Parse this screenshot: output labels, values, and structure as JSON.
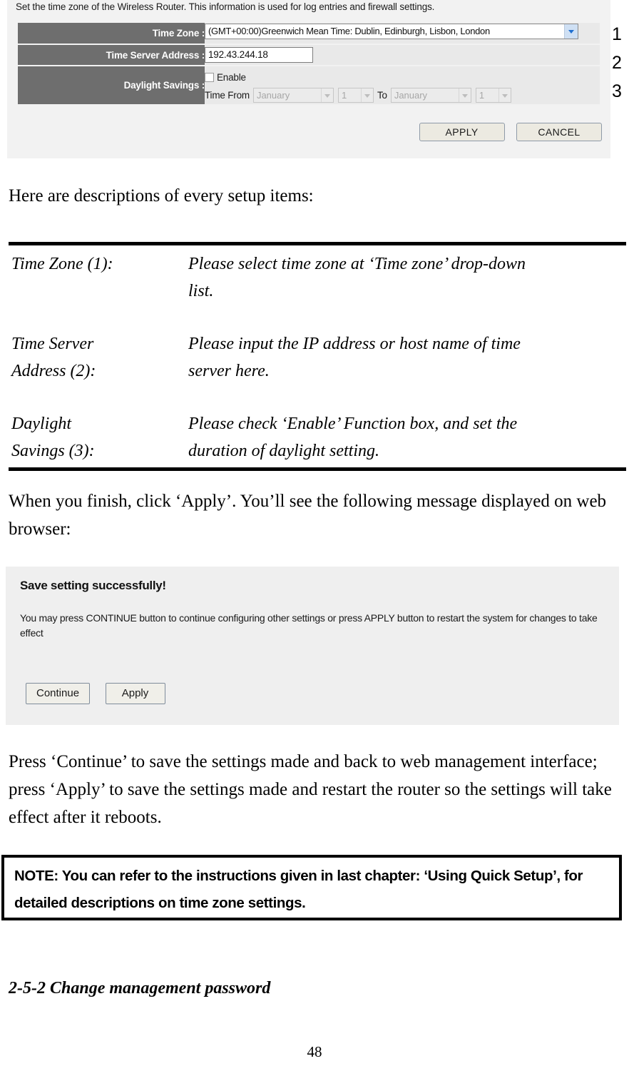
{
  "router_screenshot": {
    "intro_text": "Set the time zone of the Wireless Router. This information is used for log entries and firewall settings.",
    "rows": [
      {
        "label": "Time Zone :",
        "value": "(GMT+00:00)Greenwich Mean Time: Dublin, Edinburgh, Lisbon, London",
        "callout": "1"
      },
      {
        "label": "Time Server Address :",
        "value": "192.43.244.18",
        "callout": "2"
      },
      {
        "label": "Daylight Savings :",
        "callout": "3"
      }
    ],
    "daylight": {
      "enable_label": "Enable",
      "enable_checked": false,
      "time_from_label": "Time From",
      "from_month": "January",
      "from_day": "1",
      "to_label": "To",
      "to_month": "January",
      "to_day": "1"
    },
    "buttons": {
      "apply": "APPLY",
      "cancel": "CANCEL"
    }
  },
  "doc": {
    "intro_line": "Here are descriptions of every setup items:",
    "descriptions": [
      {
        "term_line1": "Time Zone (1):",
        "term_line2": "",
        "desc_line1": "Please select time zone at ‘Time zone’ drop-down",
        "desc_line2": "list."
      },
      {
        "term_line1": "Time Server",
        "term_line2": "Address (2):",
        "desc_line1": "Please input the IP address or host name of time",
        "desc_line2": "server here."
      },
      {
        "term_line1": "Daylight",
        "term_line2": "Savings (3):",
        "desc_line1": "Please check ‘Enable’ Function box, and set the",
        "desc_line2": "duration of daylight setting."
      }
    ],
    "finish_paragraph": "When you finish, click ‘Apply’. You’ll see the following message displayed on web browser:",
    "press_paragraph": "Press ‘Continue’ to save the settings made and back to web management interface; press ‘Apply’ to save the settings made and restart the router so the settings will take effect after it reboots.",
    "note_text": "NOTE: You can refer to the instructions given in last chapter: ‘Using Quick Setup’, for detailed descriptions on time zone settings.",
    "section_heading": "2-5-2 Change management password",
    "page_number": "48"
  },
  "save_panel": {
    "title": "Save setting successfully!",
    "body": "You may press CONTINUE button to continue configuring other settings or press APPLY button to restart the system for changes to take effect",
    "continue_label": "Continue",
    "apply_label": "Apply"
  },
  "colors": {
    "label_cell_bg": "#6e6e6e",
    "value_cell_bg": "#e9e9e9",
    "panel_bg": "#efefef",
    "dropdown_accent": "#1f6fd0"
  }
}
